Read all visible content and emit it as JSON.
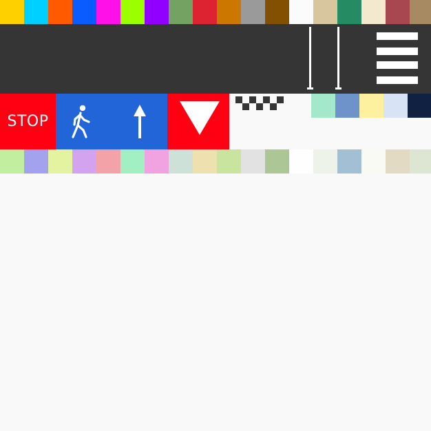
{
  "palette_top": [
    {
      "name": "yellow",
      "color": "#ffd000"
    },
    {
      "name": "cyan",
      "color": "#00d0ff"
    },
    {
      "name": "orange",
      "color": "#ff5a00"
    },
    {
      "name": "blue",
      "color": "#0a5cff"
    },
    {
      "name": "magenta",
      "color": "#ff10e8"
    },
    {
      "name": "lime",
      "color": "#9cff00"
    },
    {
      "name": "violet",
      "color": "#9100ff"
    },
    {
      "name": "sage",
      "color": "#74a262"
    },
    {
      "name": "red",
      "color": "#dd2231"
    },
    {
      "name": "ochre",
      "color": "#cb7700"
    },
    {
      "name": "gray",
      "color": "#9a9a9a"
    },
    {
      "name": "brown",
      "color": "#825000"
    },
    {
      "name": "white",
      "color": "#fbfbfb"
    },
    {
      "name": "sand",
      "color": "#d8c69f"
    },
    {
      "name": "green",
      "color": "#248b62"
    },
    {
      "name": "cream",
      "color": "#f2e9cf"
    },
    {
      "name": "brick",
      "color": "#a8474f"
    },
    {
      "name": "tan",
      "color": "#a88a62"
    }
  ],
  "palette_bottom": [
    {
      "name": "pale-green",
      "color": "#c1ee9f"
    },
    {
      "name": "periwinkle",
      "color": "#a2a2ef"
    },
    {
      "name": "pale-yellow",
      "color": "#e3f39f"
    },
    {
      "name": "lilac",
      "color": "#d3a3ef"
    },
    {
      "name": "pink",
      "color": "#f3a2a8"
    },
    {
      "name": "mint",
      "color": "#a2efc3"
    },
    {
      "name": "orchid",
      "color": "#f1a2e0"
    },
    {
      "name": "pale-teal",
      "color": "#cde1d9"
    },
    {
      "name": "beige",
      "color": "#ede1af"
    },
    {
      "name": "light-lime",
      "color": "#c9e49f"
    },
    {
      "name": "light-gray",
      "color": "#e2e2e2"
    },
    {
      "name": "olive-green",
      "color": "#adc695"
    },
    {
      "name": "white",
      "color": "#fefefe"
    },
    {
      "name": "off-white",
      "color": "#eef3e9"
    },
    {
      "name": "steel-blue",
      "color": "#a2bfd3"
    },
    {
      "name": "ivory",
      "color": "#fafaf5"
    },
    {
      "name": "khaki",
      "color": "#e2dac3"
    },
    {
      "name": "pale-sage",
      "color": "#dde5d3"
    }
  ],
  "palette_mid": [
    {
      "name": "aqua",
      "color": "#a4e8cc"
    },
    {
      "name": "denim",
      "color": "#6e93cb"
    },
    {
      "name": "butter",
      "color": "#fdf09e"
    },
    {
      "name": "ice",
      "color": "#d8e3f5"
    },
    {
      "name": "navy",
      "color": "#102142"
    }
  ],
  "road": {
    "background": "#353535",
    "marking_color": "#ffffff"
  },
  "signs": {
    "stop": {
      "label": "STOP",
      "color": "#ff0012",
      "icon": "stop-sign-icon"
    },
    "pedestrian": {
      "color": "#2165d8",
      "icon": "pedestrian-icon"
    },
    "ahead_only": {
      "color": "#2165d8",
      "icon": "arrow-up-icon"
    },
    "yield": {
      "color": "#ff0012",
      "icon": "yield-triangle-icon"
    }
  },
  "checker": {
    "icon": "checkered-flag-icon",
    "color": "#353535"
  }
}
